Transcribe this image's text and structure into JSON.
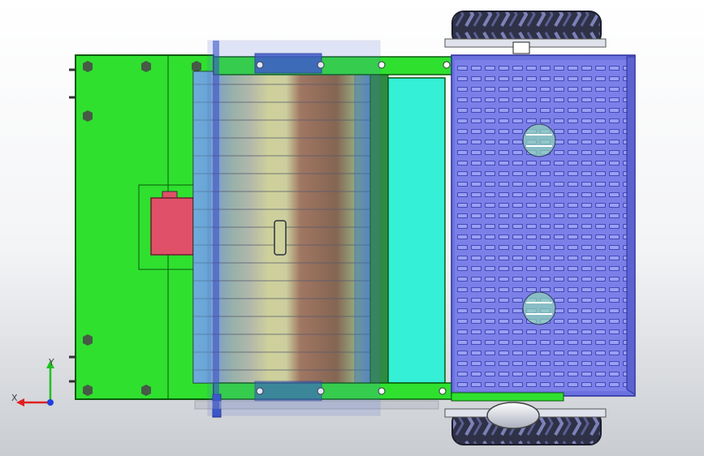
{
  "viewport": {
    "background_top": "#ffffff",
    "background_bottom": "#c9ccd1"
  },
  "colors": {
    "frame_green": "#2fe02f",
    "frame_edge": "#0b5a0b",
    "conveyor_blue": "#7b80e8",
    "conveyor_edge": "#2a2f9a",
    "slot_dark": "#3a3fb0",
    "cyan_panel": "#33f0d6",
    "motor_red": "#e05068",
    "tire_dark": "#2f3147",
    "roller_yellow": "#e8e48a",
    "roller_blue": "#8fb4d8",
    "roller_brown": "#9a6a3a"
  },
  "triad": {
    "x_label": "X",
    "y_label": "Y",
    "x_color": "#e02020",
    "y_color": "#20c020",
    "z_color": "#2040e0"
  }
}
